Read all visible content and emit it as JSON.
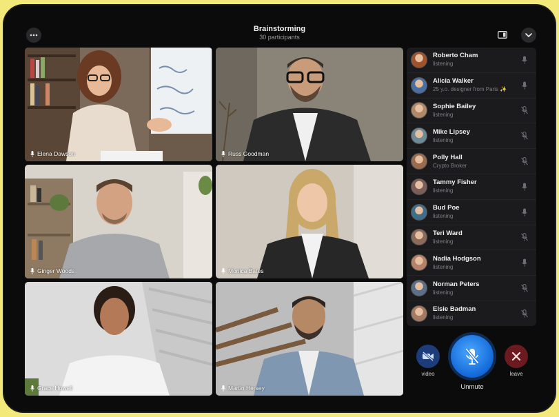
{
  "call": {
    "title": "Brainstorming",
    "subtitle": "30 participants"
  },
  "icons": {
    "more": "more-horizontal-icon",
    "layout": "layout-toggle-icon",
    "collapse": "chevron-down-icon"
  },
  "tiles": [
    {
      "name": "Elena Dawson",
      "scene": "elena"
    },
    {
      "name": "Russ Goodman",
      "scene": "russ"
    },
    {
      "name": "Ginger Woods",
      "scene": "ginger"
    },
    {
      "name": "Monica Bates",
      "scene": "monica"
    },
    {
      "name": "Grace Howell",
      "scene": "grace"
    },
    {
      "name": "Martin Hersey",
      "scene": "martin"
    }
  ],
  "participants": [
    {
      "name": "Roberto Cham",
      "status": "listening",
      "mic": "on"
    },
    {
      "name": "Alicia Walker",
      "status": "25 y.o. designer from Paris ✨",
      "mic": "on"
    },
    {
      "name": "Sophie Bailey",
      "status": "listening",
      "mic": "off"
    },
    {
      "name": "Mike Lipsey",
      "status": "listening",
      "mic": "off"
    },
    {
      "name": "Polly Hall",
      "status": "Crypto Broker",
      "mic": "off"
    },
    {
      "name": "Tammy Fisher",
      "status": "listening",
      "mic": "on"
    },
    {
      "name": "Bud Poe",
      "status": "listening",
      "mic": "on"
    },
    {
      "name": "Teri Ward",
      "status": "listening",
      "mic": "off"
    },
    {
      "name": "Nadia Hodgson",
      "status": "listening",
      "mic": "on"
    },
    {
      "name": "Norman Peters",
      "status": "listening",
      "mic": "off"
    },
    {
      "name": "Elsie Badman",
      "status": "listening",
      "mic": "off"
    }
  ],
  "controls": {
    "video_label": "video",
    "unmute_label": "Unmute",
    "leave_label": "leave"
  },
  "colors": {
    "unmute": "#1e80f0",
    "video_bg": "#1d3d7a",
    "leave_bg": "#6b1b20",
    "panel": "#1b1b1d",
    "frame": "#f3e97a"
  }
}
